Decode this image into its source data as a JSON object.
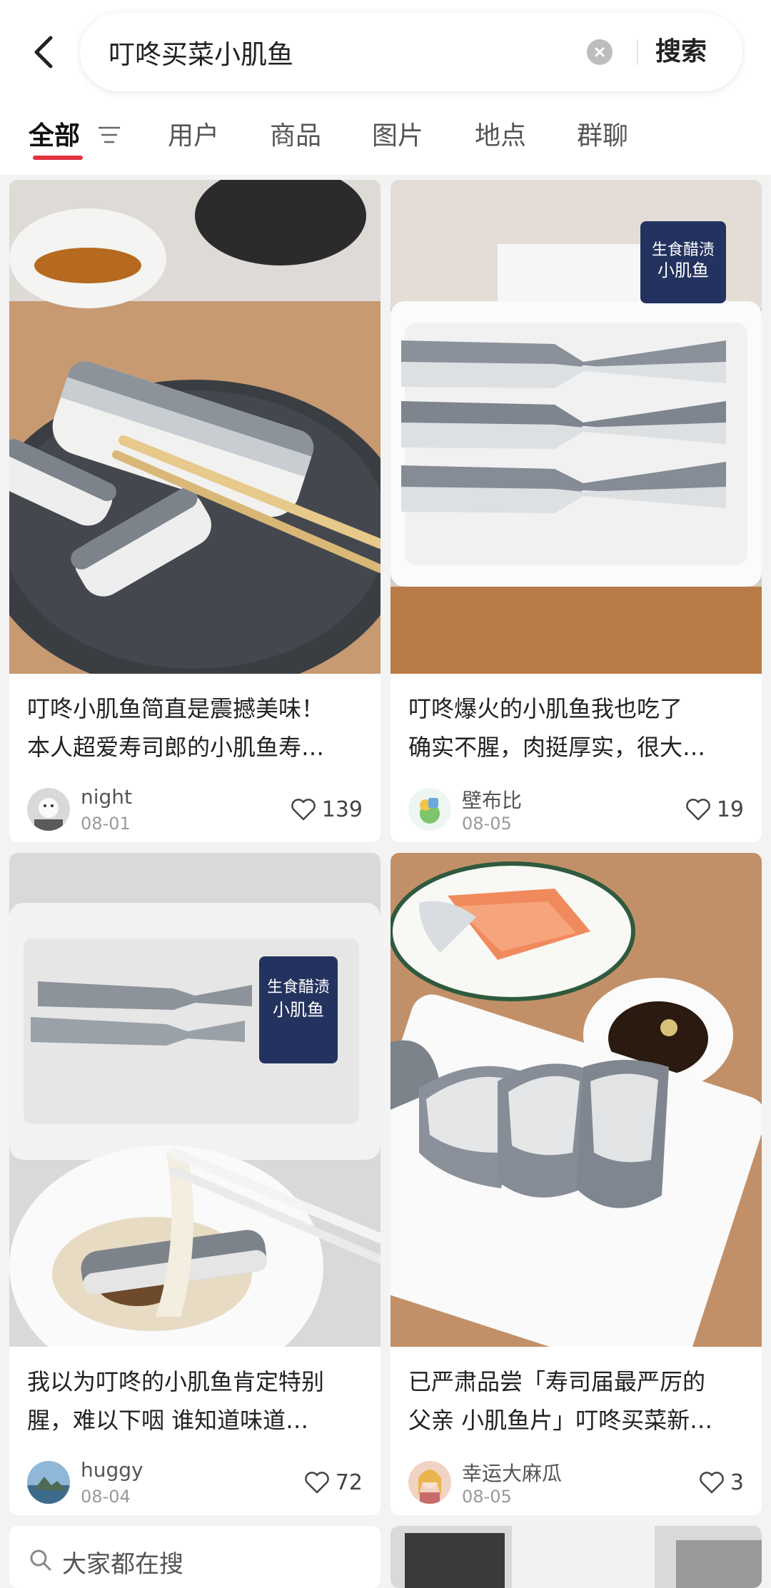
{
  "search": {
    "query": "叮咚买菜小肌鱼",
    "button_label": "搜索"
  },
  "tabs": [
    {
      "label": "全部"
    },
    {
      "label": "用户"
    },
    {
      "label": "商品"
    },
    {
      "label": "图片"
    },
    {
      "label": "地点"
    },
    {
      "label": "群聊"
    }
  ],
  "posts": [
    {
      "title_line1": "叮咚小肌鱼简直是震撼美味！",
      "title_line2": "本人超爱寿司郎的小肌鱼寿…",
      "author": "night",
      "date": "08-01",
      "likes": "139"
    },
    {
      "title_line1": "叮咚爆火的小肌鱼我也吃了",
      "title_line2": "确实不腥，肉挺厚实，很大…",
      "author": "壁布比",
      "date": "08-05",
      "likes": "19"
    },
    {
      "title_line1": "我以为叮咚的小肌鱼肯定特别",
      "title_line2": "腥，难以下咽 谁知道味道…",
      "author": "huggy",
      "date": "08-04",
      "likes": "72"
    },
    {
      "title_line1": "已严肃品尝「寿司届最严厉的",
      "title_line2": "父亲 小肌鱼片」叮咚买菜新…",
      "author": "幸运大麻瓜",
      "date": "08-05",
      "likes": "3"
    }
  ],
  "package_text": {
    "line1": "生食醋渍",
    "line2": "小肌鱼"
  },
  "trending": {
    "label": "大家都在搜"
  },
  "colors": {
    "accent": "#e2323f",
    "background": "#f3f3f3"
  },
  "icons": [
    "back-arrow-icon",
    "clear-icon",
    "filter-icon",
    "heart-icon",
    "search-icon"
  ]
}
